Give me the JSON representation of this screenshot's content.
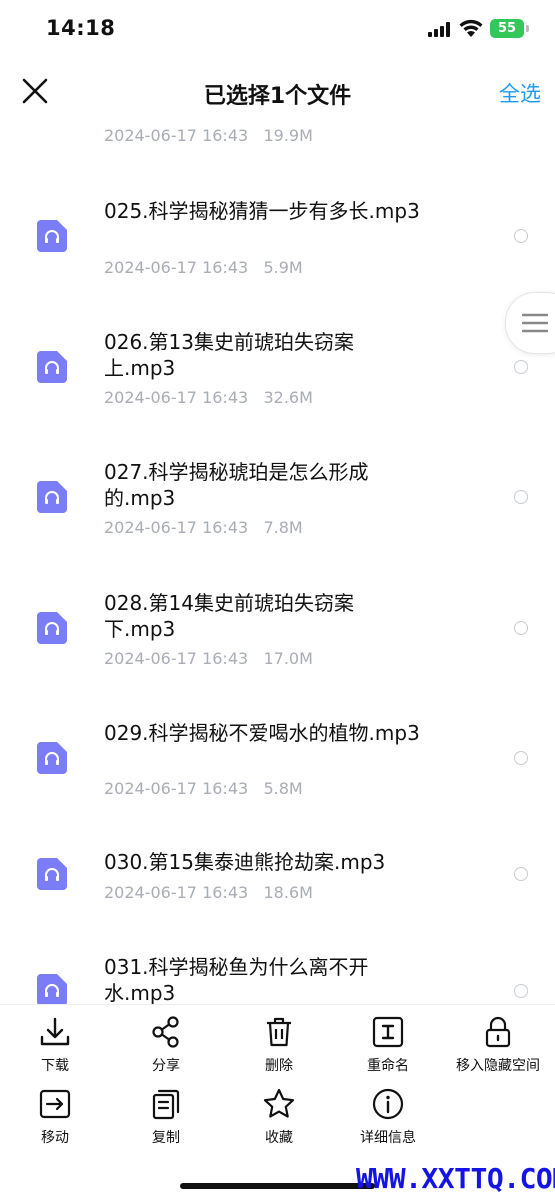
{
  "status_bar": {
    "time": "14:18",
    "battery": "55"
  },
  "header": {
    "title": "已选择1个文件",
    "select_all": "全选"
  },
  "first_item_meta": {
    "date": "2024-06-17 16:43",
    "size": "19.9M"
  },
  "files": [
    {
      "name": "025.科学揭秘猜猜一步有多长.mp3",
      "date": "2024-06-17 16:43",
      "size": "5.9M"
    },
    {
      "name": "026.第13集史前琥珀失窃案上.mp3",
      "date": "2024-06-17 16:43",
      "size": "32.6M"
    },
    {
      "name": "027.科学揭秘琥珀是怎么形成的.mp3",
      "date": "2024-06-17 16:43",
      "size": "7.8M"
    },
    {
      "name": "028.第14集史前琥珀失窃案下.mp3",
      "date": "2024-06-17 16:43",
      "size": "17.0M"
    },
    {
      "name": "029.科学揭秘不爱喝水的植物.mp3",
      "date": "2024-06-17 16:43",
      "size": "5.8M"
    },
    {
      "name": "030.第15集泰迪熊抢劫案.mp3",
      "date": "2024-06-17 16:43",
      "size": "18.6M"
    },
    {
      "name": "031.科学揭秘鱼为什么离不开水.mp3",
      "date": "",
      "size": ""
    }
  ],
  "toolbar": {
    "download": "下载",
    "share": "分享",
    "delete": "删除",
    "rename": "重命名",
    "move_to_private": "移入隐藏空间",
    "move": "移动",
    "copy": "复制",
    "favorite": "收藏",
    "details": "详细信息"
  },
  "watermark": "WWW.XXTTQ.COM",
  "colors": {
    "accent": "#1e9bf0",
    "file_icon": "#7b7df7",
    "meta": "#a9adb5",
    "battery": "#34c759",
    "watermark": "#1414e6"
  }
}
